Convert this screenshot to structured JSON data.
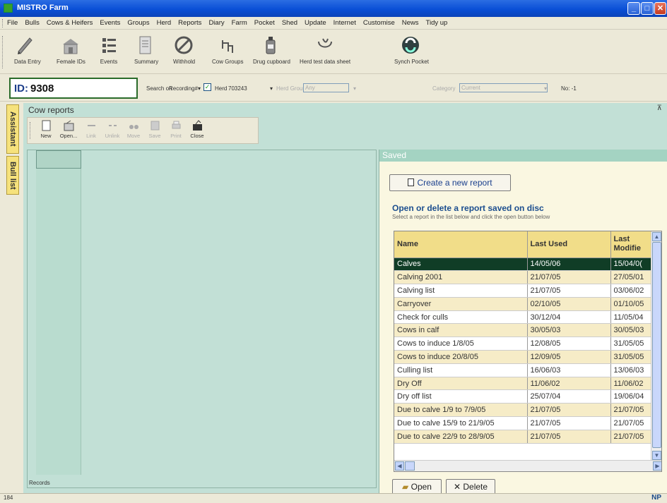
{
  "window": {
    "title": "MISTRO Farm",
    "min": "_",
    "max": "□",
    "close": "✕"
  },
  "menu": [
    "File",
    "Bulls",
    "Cows & Heifers",
    "Events",
    "Groups",
    "Herd",
    "Reports",
    "Diary",
    "Farm",
    "Pocket",
    "Shed",
    "Update",
    "Internet",
    "Customise",
    "News",
    "Tidy up"
  ],
  "toolbar": {
    "items": [
      {
        "label": "Data Entry",
        "icon": "pencil-icon"
      },
      {
        "label": "Female IDs",
        "icon": "barn-icon"
      },
      {
        "label": "Events",
        "icon": "list-icon"
      },
      {
        "label": "Summary",
        "icon": "document-icon"
      },
      {
        "label": "Withhold",
        "icon": "no-entry-icon"
      },
      {
        "label": "Cow Groups",
        "icon": "groups-icon"
      },
      {
        "label": "Drug cupboard",
        "icon": "bottle-icon"
      },
      {
        "label": "Herd test data sheet",
        "icon": "test-sheet-icon"
      },
      {
        "label": "Synch Pocket",
        "icon": "sync-icon"
      }
    ]
  },
  "idbar": {
    "id_label": "ID:",
    "id_value": "9308",
    "search_on_label": "Search on",
    "search_on_value": "Recording#",
    "herd_label": "Herd",
    "herd_value": "703243",
    "herd_group_label": "Herd Group",
    "herd_group_value": "Any",
    "category_label": "Category",
    "category_value": "Current",
    "no_label": "No: -1"
  },
  "left_tabs": {
    "assistant": "Assistant",
    "bull_list": "Bull list"
  },
  "cow_reports": {
    "title": "Cow reports",
    "pin": "⊼",
    "toolbar": [
      {
        "label": "New",
        "enabled": true
      },
      {
        "label": "Open...",
        "enabled": true
      },
      {
        "label": "Link",
        "enabled": false
      },
      {
        "label": "Unlink",
        "enabled": false
      },
      {
        "label": "Move",
        "enabled": false
      },
      {
        "label": "Save",
        "enabled": false
      },
      {
        "label": "Print",
        "enabled": false
      },
      {
        "label": "Close",
        "enabled": true
      }
    ],
    "records_label": "Records"
  },
  "saved": {
    "header": "Saved",
    "create_button": "Create a new report",
    "heading": "Open or delete a report saved on disc",
    "subheading": "Select a report in the list below and click the open button below",
    "columns": [
      "Name",
      "Last Used",
      "Last Modifie"
    ],
    "rows": [
      [
        "Calves",
        "14/05/06",
        "15/04/0("
      ],
      [
        "Calving 2001",
        "21/07/05",
        "27/05/01"
      ],
      [
        "Calving list",
        "21/07/05",
        "03/06/02"
      ],
      [
        "Carryover",
        "02/10/05",
        "01/10/05"
      ],
      [
        "Check for culls",
        "30/12/04",
        "11/05/04"
      ],
      [
        "Cows in calf",
        "30/05/03",
        "30/05/03"
      ],
      [
        "Cows to induce 1/8/05",
        "12/08/05",
        "31/05/05"
      ],
      [
        "Cows to induce 20/8/05",
        "12/09/05",
        "31/05/05"
      ],
      [
        "Culling list",
        "16/06/03",
        "13/06/03"
      ],
      [
        "Dry Off",
        "11/06/02",
        "11/06/02"
      ],
      [
        "Dry off list",
        "25/07/04",
        "19/06/04"
      ],
      [
        "Due to calve 1/9 to 7/9/05",
        "21/07/05",
        "21/07/05"
      ],
      [
        "Due to calve 15/9 to 21/9/05",
        "21/07/05",
        "21/07/05"
      ],
      [
        "Due to calve 22/9 to 28/9/05",
        "21/07/05",
        "21/07/05"
      ]
    ],
    "selected_row": 0,
    "open_button": "Open",
    "delete_button": "Delete"
  },
  "status": {
    "left": "184",
    "right": "NP"
  }
}
